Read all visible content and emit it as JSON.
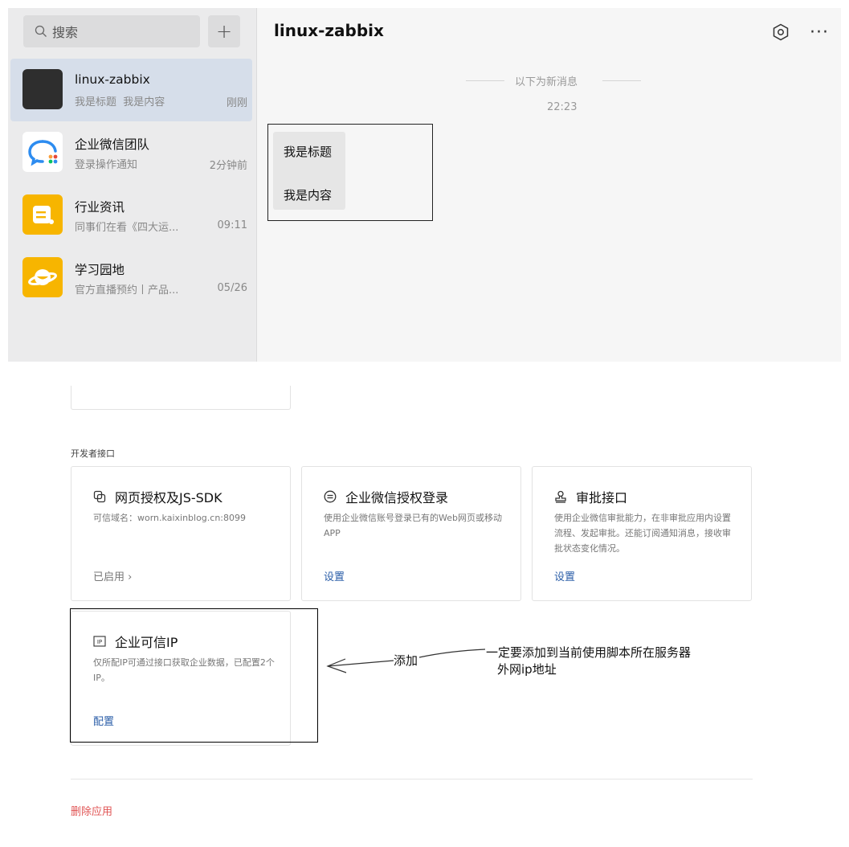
{
  "chat": {
    "search_placeholder": "搜索",
    "plus_label": "+",
    "conversations": [
      {
        "name": "linux-zabbix",
        "preview": "我是标题  我是内容",
        "time": "刚刚"
      },
      {
        "name": "企业微信团队",
        "preview": "登录操作通知",
        "time": "2分钟前"
      },
      {
        "name": "行业资讯",
        "preview": "同事们在看《四大运...",
        "time": "09:11"
      },
      {
        "name": "学习园地",
        "preview": "官方直播预约丨产品...",
        "time": "05/26"
      }
    ],
    "title": "linux-zabbix",
    "more_label": "···",
    "new_messages_divider": "以下为新消息",
    "time": "22:23",
    "message": {
      "line1": "我是标题",
      "line2": "我是内容"
    }
  },
  "admin": {
    "section_label": "开发者接口",
    "cards": [
      {
        "icon": "link-icon",
        "title": "网页授权及JS-SDK",
        "desc": "可信域名：worn.kaixinblog.cn:8099",
        "action": "已启用 ›"
      },
      {
        "icon": "equal-circle-icon",
        "title": "企业微信授权登录",
        "desc": "使用企业微信账号登录已有的Web网页或移动APP",
        "action": "设置"
      },
      {
        "icon": "stamp-icon",
        "title": "审批接口",
        "desc": "使用企业微信审批能力，在非审批应用内设置流程、发起审批。还能订阅通知消息，接收审批状态变化情况。",
        "action": "设置"
      },
      {
        "icon": "ip-icon",
        "title": "企业可信IP",
        "desc": "仅所配IP可通过接口获取企业数据，已配置2个IP。",
        "action": "配置"
      }
    ],
    "delete_label": "删除应用"
  },
  "annotation": {
    "add_label": "添加",
    "note_line1": "一定要添加到当前使用脚本所在服务器",
    "note_line2": "外网ip地址"
  },
  "colors": {
    "active_conversation": "#d6deea",
    "link_blue": "#2b5ea8",
    "danger_red": "#e05454",
    "sidebar_bg": "#ebebec"
  }
}
